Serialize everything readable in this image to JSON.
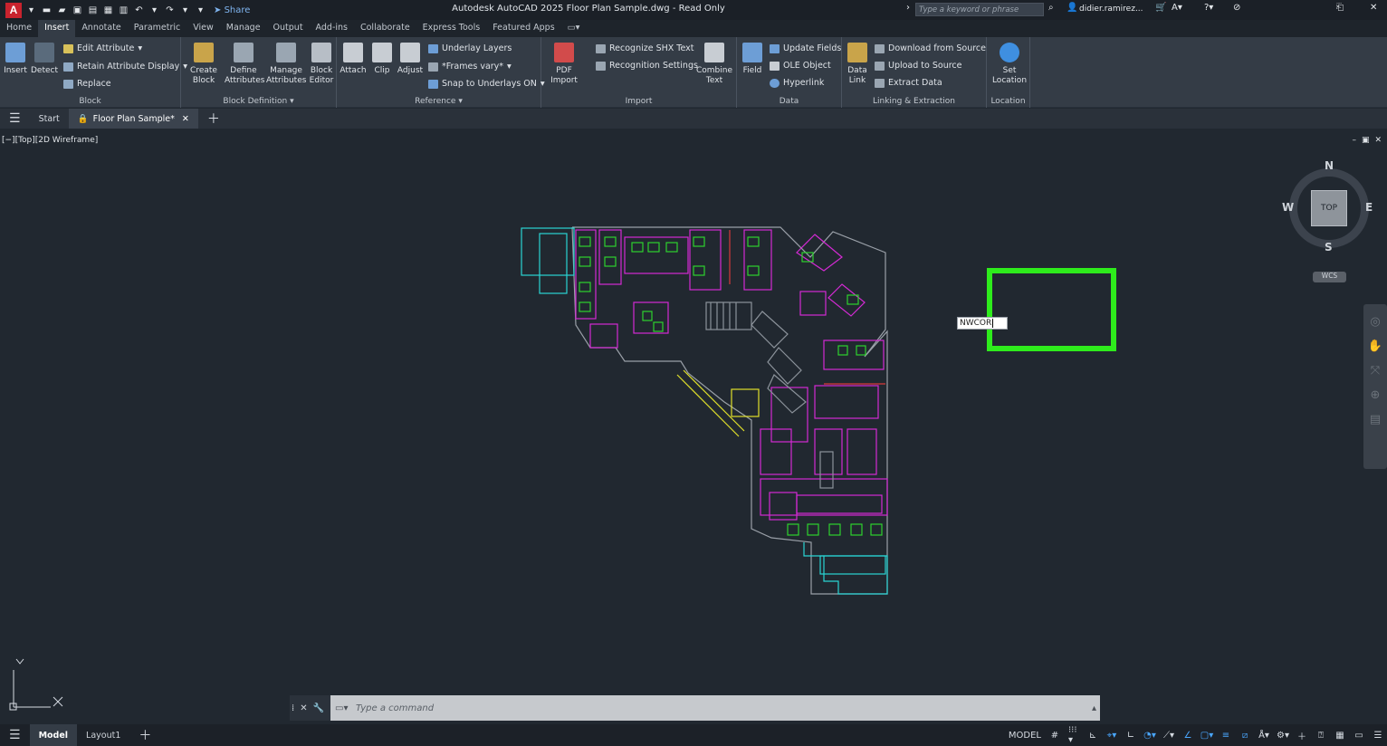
{
  "titlebar": {
    "logo": "A",
    "share": "Share",
    "title": "Autodesk AutoCAD 2025   Floor Plan Sample.dwg - Read Only",
    "search_placeholder": "Type a keyword or phrase",
    "user": "didier.ramirez..."
  },
  "ribbon_tabs": [
    "Home",
    "Insert",
    "Annotate",
    "Parametric",
    "View",
    "Manage",
    "Output",
    "Add-ins",
    "Collaborate",
    "Express Tools",
    "Featured Apps"
  ],
  "active_tab": "Insert",
  "ribbon": {
    "block": {
      "title": "Block",
      "insert": "Insert",
      "detect": "Detect",
      "edit_attribute": "Edit Attribute",
      "retain": "Retain Attribute Display",
      "replace": "Replace"
    },
    "blockdef": {
      "title": "Block Definition",
      "create": [
        "Create",
        "Block"
      ],
      "define": [
        "Define",
        "Attributes"
      ],
      "manage": [
        "Manage",
        "Attributes"
      ],
      "editor": [
        "Block",
        "Editor"
      ]
    },
    "reference": {
      "title": "Reference",
      "attach": "Attach",
      "clip": "Clip",
      "adjust": "Adjust",
      "underlay_layers": "Underlay Layers",
      "frames": "*Frames vary*",
      "snap": "Snap to Underlays ON"
    },
    "import": {
      "title": "Import",
      "pdf": [
        "PDF",
        "Import"
      ],
      "recognize": "Recognize SHX Text",
      "recognition": "Recognition Settings",
      "combine": [
        "Combine",
        "Text"
      ]
    },
    "data": {
      "title": "Data",
      "field": "Field",
      "update": "Update Fields",
      "ole": "OLE Object",
      "hyperlink": "Hyperlink"
    },
    "linking": {
      "title": "Linking & Extraction",
      "datalink": [
        "Data",
        "Link"
      ],
      "download": "Download from Source",
      "upload": "Upload to Source",
      "extract": "Extract  Data"
    },
    "location": {
      "title": "Location",
      "set": [
        "Set",
        "Location"
      ]
    }
  },
  "doc_tabs": {
    "start": "Start",
    "active": "Floor Plan Sample*"
  },
  "viewport": {
    "label": "[−][Top][2D Wireframe]",
    "dyn_input": "NWCOR",
    "viewcube": {
      "top": "TOP",
      "n": "N",
      "s": "S",
      "e": "E",
      "w": "W",
      "wcs": "WCS"
    }
  },
  "command": {
    "placeholder": "Type a command"
  },
  "status": {
    "model": "Model",
    "layout": "Layout1",
    "mode": "MODEL"
  },
  "colors": {
    "accent": "#2b6fd6",
    "highlight": "#2eec1c",
    "cyan": "#29d4d4",
    "magenta": "#d42ad4",
    "green": "#2ed12e",
    "yellow": "#e0e02a"
  }
}
